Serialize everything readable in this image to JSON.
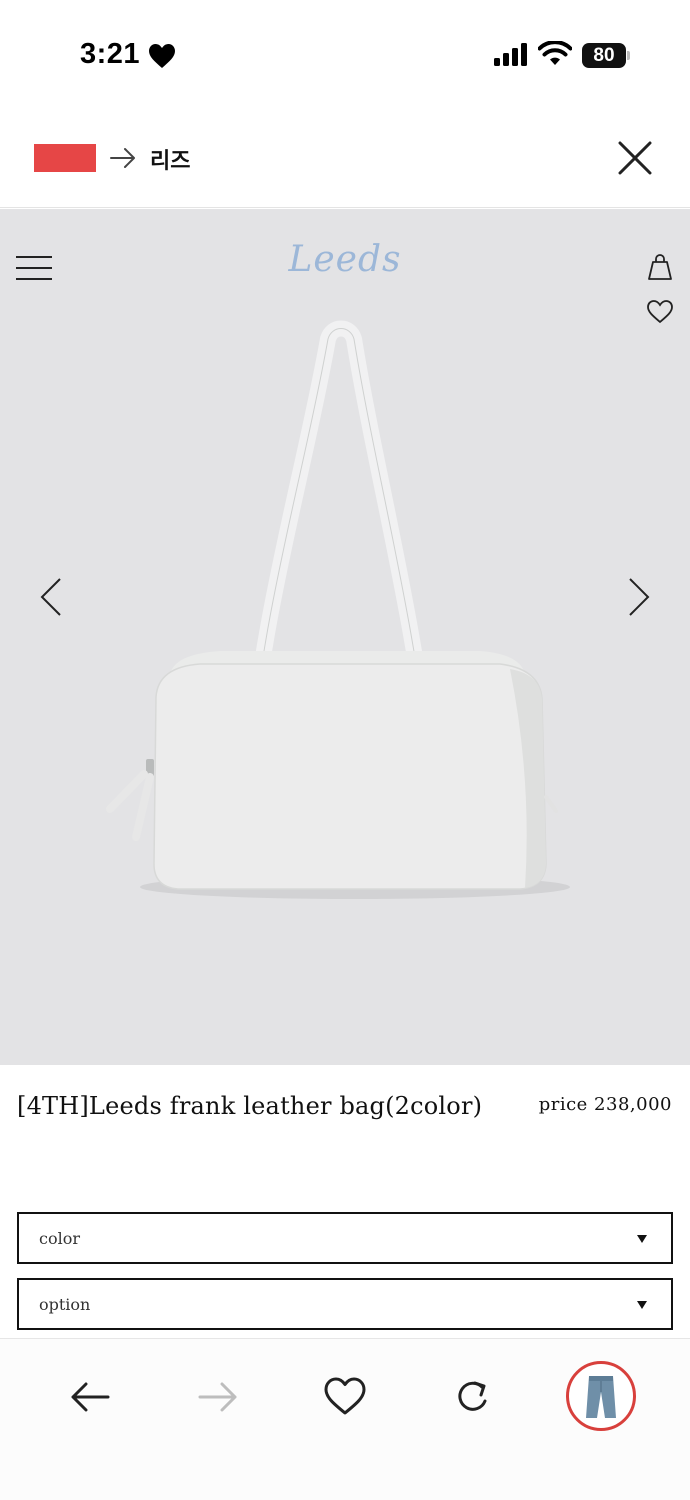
{
  "status_bar": {
    "time": "3:21",
    "battery_percent": "80",
    "signal_bars": 4
  },
  "top_bar": {
    "label": "리즈",
    "chip_color": "#e64646"
  },
  "hero": {
    "brand": "Leeds",
    "brand_color": "#9cb7d8",
    "background_color": "#e3e3e5"
  },
  "product": {
    "title": "[4TH]Leeds frank leather bag(2color)",
    "price": "price 238,000"
  },
  "selects": {
    "color_label": "color",
    "option_label": "option"
  },
  "icons": {
    "status_heart": "heart-icon",
    "menu": "hamburger-menu-icon",
    "bag": "shopping-bag-icon",
    "wishlist": "heart-outline-icon",
    "prev": "chevron-left-icon",
    "next": "chevron-right-icon",
    "close": "close-icon",
    "back": "arrow-left-icon",
    "forward": "arrow-right-icon",
    "refresh": "refresh-icon",
    "avatar": "jeans-avatar"
  },
  "bottom_bar": {
    "avatar_ring_color": "#d8403c"
  }
}
